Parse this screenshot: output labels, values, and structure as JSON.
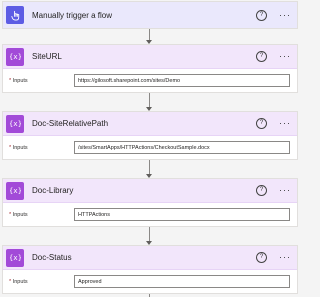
{
  "trigger": {
    "title": "Manually trigger a flow",
    "icon": "hand-touch-icon"
  },
  "actions": [
    {
      "title": "SiteURL",
      "label": "Inputs",
      "required": "*",
      "value": "https://gilosoft.sharepoint.com/sites/Demo",
      "icon": "variable-icon"
    },
    {
      "title": "Doc-SiteRelativePath",
      "label": "Inputs",
      "required": "*",
      "value": "/sites/SmartApps/HTTPActions/CheckoutSample.docx",
      "icon": "variable-icon"
    },
    {
      "title": "Doc-Library",
      "label": "Inputs",
      "required": "*",
      "value": "HTTPActions",
      "icon": "variable-icon"
    },
    {
      "title": "Doc-Status",
      "label": "Inputs",
      "required": "*",
      "value": "Approved",
      "icon": "variable-icon"
    }
  ],
  "help_glyph": "?",
  "more_glyph": "···",
  "colors": {
    "trigger_accent": "#5d5ce4",
    "trigger_header": "#eae8fc",
    "variable_accent": "#a24ad8",
    "variable_header": "#f2e6fb"
  }
}
